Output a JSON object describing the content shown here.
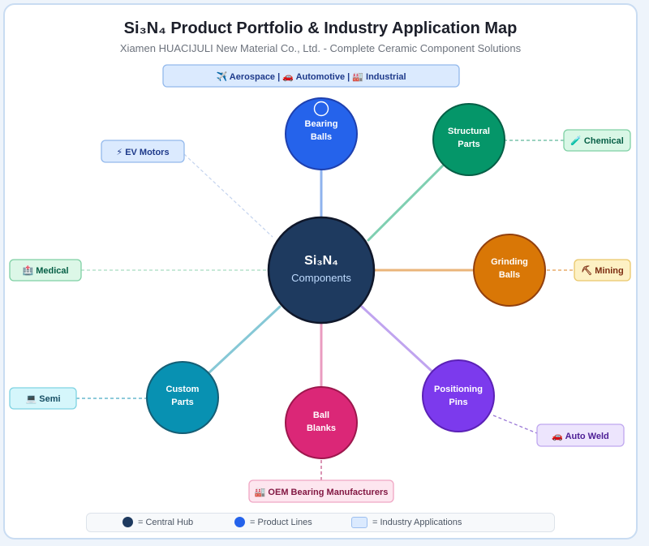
{
  "header": {
    "title": "Si₃N₄ Product Portfolio & Industry Application Map",
    "subtitle": "Xiamen HUACIJULI New Material Co., Ltd. - Complete Ceramic Component Solutions",
    "banner": "✈️ Aerospace | 🚗 Automotive | 🏭 Industrial"
  },
  "hub": {
    "line1": "Si₃N₄",
    "line2": "Components",
    "color": "#1e3a5f"
  },
  "products": [
    {
      "id": "bearing-balls",
      "line1": "Bearing",
      "line2": "Balls",
      "color": "#2563eb",
      "link_color": "#8fb3ee"
    },
    {
      "id": "structural-parts",
      "line1": "Structural",
      "line2": "Parts",
      "color": "#059669",
      "link_color": "#7fcfb1"
    },
    {
      "id": "grinding-balls",
      "line1": "Grinding",
      "line2": "Balls",
      "color": "#d97706",
      "link_color": "#eab57b"
    },
    {
      "id": "positioning-pins",
      "line1": "Positioning",
      "line2": "Pins",
      "color": "#7c3aed",
      "link_color": "#c0a4ef"
    },
    {
      "id": "ball-blanks",
      "line1": "Ball",
      "line2": "Blanks",
      "color": "#db2777",
      "link_color": "#ea9cc0"
    },
    {
      "id": "custom-parts",
      "line1": "Custom",
      "line2": "Parts",
      "color": "#0891b2",
      "link_color": "#86c8d6"
    }
  ],
  "industries": [
    {
      "id": "ev-motors",
      "icon": "⚡",
      "label": "EV Motors",
      "bg": "#dbeafe",
      "border": "#93b9ec",
      "text": "#1e3a8a"
    },
    {
      "id": "chemical",
      "icon": "🧪",
      "label": "Chemical",
      "bg": "#d9f7e6",
      "border": "#7fd0a4",
      "text": "#065f46"
    },
    {
      "id": "medical",
      "icon": "🏥",
      "label": "Medical",
      "bg": "#dcf7e7",
      "border": "#7fd0a4",
      "text": "#065f46"
    },
    {
      "id": "mining",
      "icon": "⛏",
      "label": "Mining",
      "bg": "#fdf1c4",
      "border": "#e9c76a",
      "text": "#7c2d12"
    },
    {
      "id": "semi",
      "icon": "💻",
      "label": "Semi",
      "bg": "#d5f6fb",
      "border": "#7fd3e2",
      "text": "#164e63"
    },
    {
      "id": "auto-weld",
      "icon": "🚗",
      "label": "Auto Weld",
      "bg": "#ede5fd",
      "border": "#bfa7ef",
      "text": "#4c1d95"
    },
    {
      "id": "oem",
      "icon": "🏭",
      "label": "OEM Bearing Manufacturers",
      "bg": "#fde6ef",
      "border": "#f0a6c4",
      "text": "#831843"
    }
  ],
  "legend": {
    "hub_label": "= Central Hub",
    "product_label": "= Product Lines",
    "industry_label": "= Industry Applications",
    "hub_color": "#1e3a5f",
    "product_color": "#2563eb"
  }
}
